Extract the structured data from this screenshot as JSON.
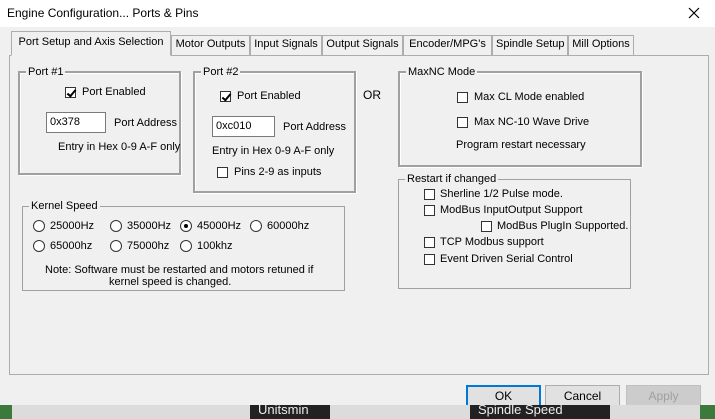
{
  "window": {
    "title": "Engine Configuration... Ports & Pins"
  },
  "tabs": [
    {
      "label": "Port Setup and Axis Selection",
      "active": true
    },
    {
      "label": "Motor Outputs"
    },
    {
      "label": "Input Signals"
    },
    {
      "label": "Output Signals"
    },
    {
      "label": "Encoder/MPG's"
    },
    {
      "label": "Spindle Setup"
    },
    {
      "label": "Mill Options"
    }
  ],
  "port1": {
    "legend": "Port #1",
    "enabled_label": "Port Enabled",
    "enabled": true,
    "address_value": "0x378",
    "address_label": "Port Address",
    "hint": "Entry in Hex 0-9 A-F only"
  },
  "port2": {
    "legend": "Port #2",
    "enabled_label": "Port Enabled",
    "enabled": true,
    "address_value": "0xc010",
    "address_label": "Port Address",
    "hint": "Entry in Hex 0-9 A-F only",
    "pins_label": "Pins 2-9 as inputs",
    "pins_checked": false
  },
  "or_label": "OR",
  "maxnc": {
    "legend": "MaxNC Mode",
    "cl_label": "Max CL Mode enabled",
    "wave_label": "Max NC-10 Wave Drive",
    "note": "Program restart necessary"
  },
  "kernel": {
    "legend": "Kernel Speed",
    "options": [
      "25000Hz",
      "35000Hz",
      "45000Hz",
      "60000hz",
      "65000hz",
      "75000hz",
      "100khz"
    ],
    "selected": "45000Hz",
    "note_line1": "Note: Software must be restarted and motors retuned if",
    "note_line2": "kernel speed is changed."
  },
  "restart": {
    "legend": "Restart if changed",
    "sherline": "Sherline 1/2 Pulse mode.",
    "modbus_io": "ModBus InputOutput Support",
    "modbus_plugin": "ModBus PlugIn Supported.",
    "tcp_modbus": "TCP Modbus support",
    "event_serial": "Event Driven Serial Control"
  },
  "buttons": {
    "ok": "OK",
    "cancel": "Cancel",
    "apply": "Apply"
  },
  "background": {
    "partial_left": "Unitsmin",
    "partial_right": "Spindle Speed"
  }
}
